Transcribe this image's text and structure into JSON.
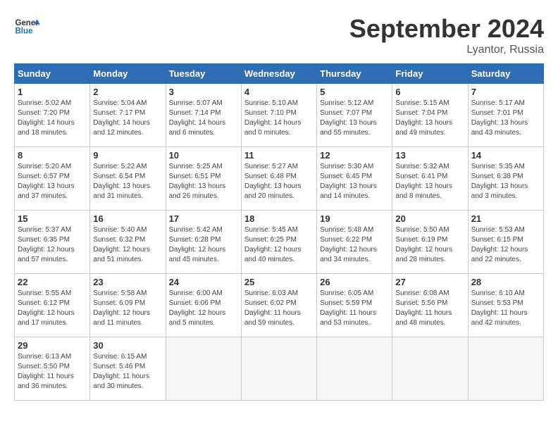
{
  "header": {
    "logo_general": "General",
    "logo_blue": "Blue",
    "month_title": "September 2024",
    "location": "Lyantor, Russia"
  },
  "days_of_week": [
    "Sunday",
    "Monday",
    "Tuesday",
    "Wednesday",
    "Thursday",
    "Friday",
    "Saturday"
  ],
  "weeks": [
    [
      {
        "day": "1",
        "info": "Sunrise: 5:02 AM\nSunset: 7:20 PM\nDaylight: 14 hours\nand 18 minutes."
      },
      {
        "day": "2",
        "info": "Sunrise: 5:04 AM\nSunset: 7:17 PM\nDaylight: 14 hours\nand 12 minutes."
      },
      {
        "day": "3",
        "info": "Sunrise: 5:07 AM\nSunset: 7:14 PM\nDaylight: 14 hours\nand 6 minutes."
      },
      {
        "day": "4",
        "info": "Sunrise: 5:10 AM\nSunset: 7:10 PM\nDaylight: 14 hours\nand 0 minutes."
      },
      {
        "day": "5",
        "info": "Sunrise: 5:12 AM\nSunset: 7:07 PM\nDaylight: 13 hours\nand 55 minutes."
      },
      {
        "day": "6",
        "info": "Sunrise: 5:15 AM\nSunset: 7:04 PM\nDaylight: 13 hours\nand 49 minutes."
      },
      {
        "day": "7",
        "info": "Sunrise: 5:17 AM\nSunset: 7:01 PM\nDaylight: 13 hours\nand 43 minutes."
      }
    ],
    [
      {
        "day": "8",
        "info": "Sunrise: 5:20 AM\nSunset: 6:57 PM\nDaylight: 13 hours\nand 37 minutes."
      },
      {
        "day": "9",
        "info": "Sunrise: 5:22 AM\nSunset: 6:54 PM\nDaylight: 13 hours\nand 31 minutes."
      },
      {
        "day": "10",
        "info": "Sunrise: 5:25 AM\nSunset: 6:51 PM\nDaylight: 13 hours\nand 26 minutes."
      },
      {
        "day": "11",
        "info": "Sunrise: 5:27 AM\nSunset: 6:48 PM\nDaylight: 13 hours\nand 20 minutes."
      },
      {
        "day": "12",
        "info": "Sunrise: 5:30 AM\nSunset: 6:45 PM\nDaylight: 13 hours\nand 14 minutes."
      },
      {
        "day": "13",
        "info": "Sunrise: 5:32 AM\nSunset: 6:41 PM\nDaylight: 13 hours\nand 8 minutes."
      },
      {
        "day": "14",
        "info": "Sunrise: 5:35 AM\nSunset: 6:38 PM\nDaylight: 13 hours\nand 3 minutes."
      }
    ],
    [
      {
        "day": "15",
        "info": "Sunrise: 5:37 AM\nSunset: 6:35 PM\nDaylight: 12 hours\nand 57 minutes."
      },
      {
        "day": "16",
        "info": "Sunrise: 5:40 AM\nSunset: 6:32 PM\nDaylight: 12 hours\nand 51 minutes."
      },
      {
        "day": "17",
        "info": "Sunrise: 5:42 AM\nSunset: 6:28 PM\nDaylight: 12 hours\nand 45 minutes."
      },
      {
        "day": "18",
        "info": "Sunrise: 5:45 AM\nSunset: 6:25 PM\nDaylight: 12 hours\nand 40 minutes."
      },
      {
        "day": "19",
        "info": "Sunrise: 5:48 AM\nSunset: 6:22 PM\nDaylight: 12 hours\nand 34 minutes."
      },
      {
        "day": "20",
        "info": "Sunrise: 5:50 AM\nSunset: 6:19 PM\nDaylight: 12 hours\nand 28 minutes."
      },
      {
        "day": "21",
        "info": "Sunrise: 5:53 AM\nSunset: 6:15 PM\nDaylight: 12 hours\nand 22 minutes."
      }
    ],
    [
      {
        "day": "22",
        "info": "Sunrise: 5:55 AM\nSunset: 6:12 PM\nDaylight: 12 hours\nand 17 minutes."
      },
      {
        "day": "23",
        "info": "Sunrise: 5:58 AM\nSunset: 6:09 PM\nDaylight: 12 hours\nand 11 minutes."
      },
      {
        "day": "24",
        "info": "Sunrise: 6:00 AM\nSunset: 6:06 PM\nDaylight: 12 hours\nand 5 minutes."
      },
      {
        "day": "25",
        "info": "Sunrise: 6:03 AM\nSunset: 6:02 PM\nDaylight: 11 hours\nand 59 minutes."
      },
      {
        "day": "26",
        "info": "Sunrise: 6:05 AM\nSunset: 5:59 PM\nDaylight: 11 hours\nand 53 minutes."
      },
      {
        "day": "27",
        "info": "Sunrise: 6:08 AM\nSunset: 5:56 PM\nDaylight: 11 hours\nand 48 minutes."
      },
      {
        "day": "28",
        "info": "Sunrise: 6:10 AM\nSunset: 5:53 PM\nDaylight: 11 hours\nand 42 minutes."
      }
    ],
    [
      {
        "day": "29",
        "info": "Sunrise: 6:13 AM\nSunset: 5:50 PM\nDaylight: 11 hours\nand 36 minutes."
      },
      {
        "day": "30",
        "info": "Sunrise: 6:15 AM\nSunset: 5:46 PM\nDaylight: 11 hours\nand 30 minutes."
      },
      {
        "day": "",
        "info": ""
      },
      {
        "day": "",
        "info": ""
      },
      {
        "day": "",
        "info": ""
      },
      {
        "day": "",
        "info": ""
      },
      {
        "day": "",
        "info": ""
      }
    ]
  ]
}
